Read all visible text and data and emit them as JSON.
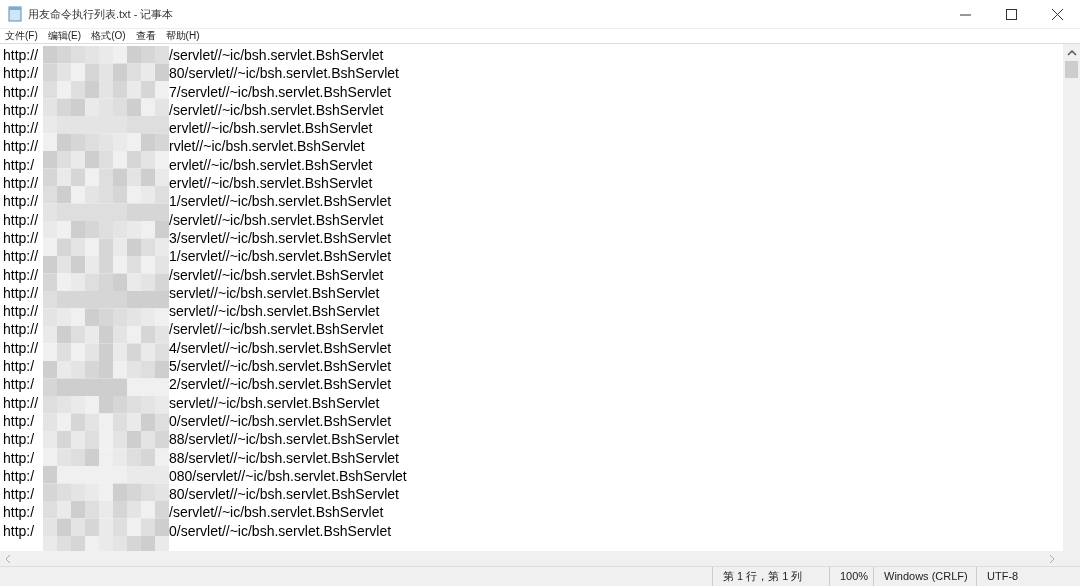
{
  "window": {
    "title": "用友命令执行列表.txt - 记事本"
  },
  "menu": [
    {
      "label": "文件(F)"
    },
    {
      "label": "编辑(E)"
    },
    {
      "label": "格式(O)"
    },
    {
      "label": "查看"
    },
    {
      "label": "帮助(H)"
    }
  ],
  "lines": [
    {
      "prefix": "http://",
      "suffix": "/servlet//~ic/bsh.servlet.BshServlet"
    },
    {
      "prefix": "http://",
      "suffix": "80/servlet//~ic/bsh.servlet.BshServlet"
    },
    {
      "prefix": "http://",
      "suffix": "7/servlet//~ic/bsh.servlet.BshServlet"
    },
    {
      "prefix": "http://",
      "suffix": "/servlet//~ic/bsh.servlet.BshServlet"
    },
    {
      "prefix": "http://",
      "suffix": "ervlet//~ic/bsh.servlet.BshServlet"
    },
    {
      "prefix": "http://",
      "suffix": "rvlet//~ic/bsh.servlet.BshServlet"
    },
    {
      "prefix": "http:/",
      "suffix": "ervlet//~ic/bsh.servlet.BshServlet"
    },
    {
      "prefix": "http://",
      "suffix": "ervlet//~ic/bsh.servlet.BshServlet"
    },
    {
      "prefix": "http://",
      "suffix": "1/servlet//~ic/bsh.servlet.BshServlet"
    },
    {
      "prefix": "http://",
      "suffix": "/servlet//~ic/bsh.servlet.BshServlet"
    },
    {
      "prefix": "http://",
      "suffix": "3/servlet//~ic/bsh.servlet.BshServlet"
    },
    {
      "prefix": "http://",
      "suffix": "1/servlet//~ic/bsh.servlet.BshServlet"
    },
    {
      "prefix": "http://",
      "suffix": "/servlet//~ic/bsh.servlet.BshServlet"
    },
    {
      "prefix": "http://",
      "suffix": "servlet//~ic/bsh.servlet.BshServlet"
    },
    {
      "prefix": "http://",
      "suffix": "servlet//~ic/bsh.servlet.BshServlet"
    },
    {
      "prefix": "http://",
      "suffix": "/servlet//~ic/bsh.servlet.BshServlet"
    },
    {
      "prefix": "http://",
      "suffix": "4/servlet//~ic/bsh.servlet.BshServlet"
    },
    {
      "prefix": "http:/",
      "suffix": "5/servlet//~ic/bsh.servlet.BshServlet"
    },
    {
      "prefix": "http:/",
      "suffix": "2/servlet//~ic/bsh.servlet.BshServlet"
    },
    {
      "prefix": "http://",
      "suffix": "servlet//~ic/bsh.servlet.BshServlet"
    },
    {
      "prefix": "http:/",
      "suffix": "0/servlet//~ic/bsh.servlet.BshServlet"
    },
    {
      "prefix": "http:/",
      "suffix": "88/servlet//~ic/bsh.servlet.BshServlet"
    },
    {
      "prefix": "http:/",
      "suffix": "88/servlet//~ic/bsh.servlet.BshServlet"
    },
    {
      "prefix": "http:/",
      "suffix": "080/servlet//~ic/bsh.servlet.BshServlet"
    },
    {
      "prefix": "http:/",
      "suffix": "80/servlet//~ic/bsh.servlet.BshServlet"
    },
    {
      "prefix": "http:/",
      "suffix": "/servlet//~ic/bsh.servlet.BshServlet"
    },
    {
      "prefix": "http:/",
      "suffix": "0/servlet//~ic/bsh.servlet.BshServlet"
    }
  ],
  "status_bar": {
    "position": "第 1 行，第 1 列",
    "zoom": "100%",
    "line_ending": "Windows (CRLF)",
    "encoding": "UTF-8"
  }
}
